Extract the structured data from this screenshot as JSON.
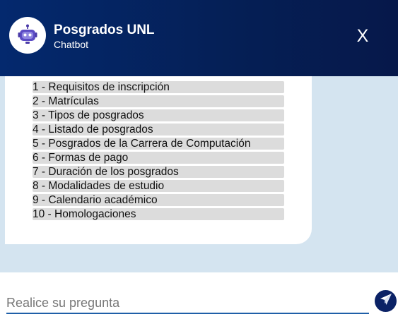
{
  "header": {
    "title": "Posgrados UNL",
    "subtitle": "Chatbot",
    "close_label": "X",
    "avatar_icon": "robot-icon"
  },
  "menu": {
    "options": [
      "1 - Requisitos de inscripción",
      "2 - Matrículas",
      "3 - Tipos de posgrados",
      "4 - Listado de posgrados",
      "5 - Posgrados de la Carrera de Computación",
      "6 - Formas de pago",
      "7 - Duración de los posgrados",
      "8 - Modalidades de estudio",
      "9 - Calendario académico",
      "10 - Homologaciones"
    ]
  },
  "input": {
    "placeholder": "Realice su pregunta",
    "value": ""
  },
  "send": {
    "icon": "paper-plane-icon"
  },
  "colors": {
    "header_bg": "#04296e",
    "chat_bg": "#d4e4f0",
    "option_bg": "#dcdcdc",
    "accent": "#1f5fa8",
    "send_bg": "#0b2266"
  }
}
